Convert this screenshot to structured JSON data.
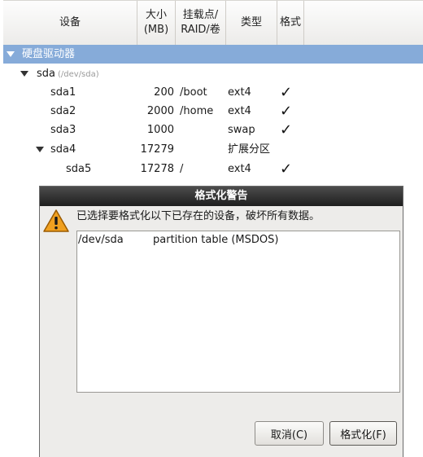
{
  "columns": {
    "device": "设备",
    "size": "大小\n(MB)",
    "mount": "挂载点/\nRAID/卷",
    "type": "类型",
    "format": "格式"
  },
  "tree": {
    "group_label": "硬盘驱动器",
    "disk": {
      "name": "sda",
      "path": "(/dev/sda)"
    },
    "partitions": [
      {
        "name": "sda1",
        "size": "200",
        "mount": "/boot",
        "type": "ext4",
        "format": "✓"
      },
      {
        "name": "sda2",
        "size": "2000",
        "mount": "/home",
        "type": "ext4",
        "format": "✓"
      },
      {
        "name": "sda3",
        "size": "1000",
        "mount": "",
        "type": "swap",
        "format": "✓"
      },
      {
        "name": "sda4",
        "size": "17279",
        "mount": "",
        "type": "扩展分区",
        "format": ""
      },
      {
        "name": "sda5",
        "size": "17278",
        "mount": "/",
        "type": "ext4",
        "format": "✓"
      }
    ]
  },
  "dialog": {
    "title": "格式化警告",
    "icon": "warning-icon",
    "message": "已选择要格式化以下已存在的设备，破坏所有数据。",
    "devices": [
      {
        "device": "/dev/sda",
        "description": "partition table (MSDOS)"
      }
    ],
    "buttons": {
      "cancel": "取消(C)",
      "format": "格式化(F)"
    }
  },
  "colors": {
    "selected_row": "#86abd9",
    "warning_fill": "#f0a020",
    "title_bar": "#2a2a2a"
  }
}
